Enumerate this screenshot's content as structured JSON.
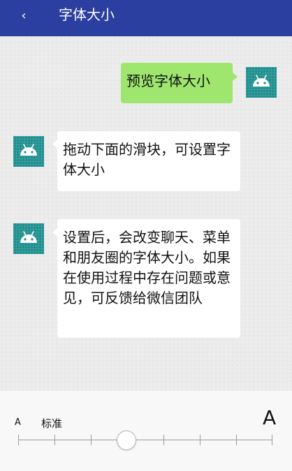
{
  "header": {
    "back_glyph": "‹",
    "title": "字体大小"
  },
  "messages": [
    {
      "side": "right",
      "text": "预览字体大小"
    },
    {
      "side": "left",
      "text": "拖动下面的滑块，可设置字体大小"
    },
    {
      "side": "left",
      "text": "设置后，会改变聊天、菜单和朋友圈的字体大小。如果在使用过程中存在问题或意见，可反馈给微信团队"
    }
  ],
  "font_slider": {
    "small_label": "A",
    "standard_label": "标准",
    "large_label": "A",
    "levels": 8,
    "selected_level": 4
  },
  "colors": {
    "header": "#2a3fa0",
    "sent_bubble": "#9ee66e",
    "received_bubble": "#ffffff",
    "avatar": "#1e8e8e"
  },
  "icons": {
    "avatar": "android-robot-icon",
    "back": "back-arrow-icon"
  }
}
